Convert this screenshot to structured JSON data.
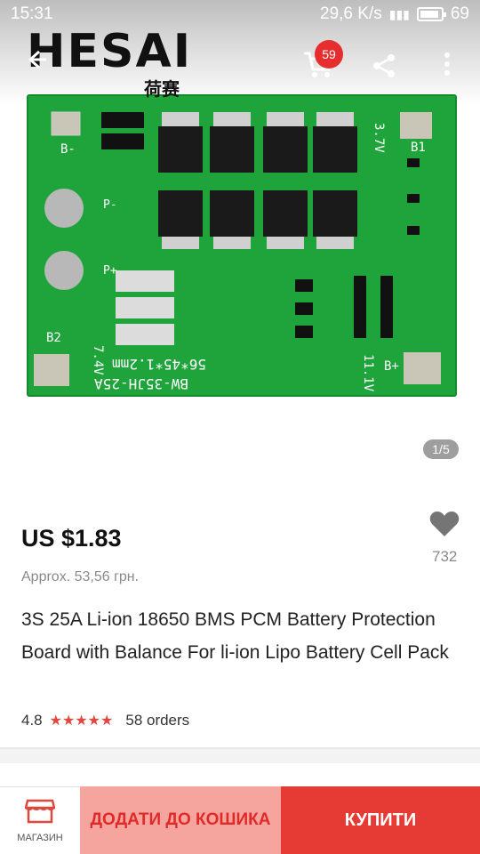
{
  "status_bar": {
    "time": "15:31",
    "network_speed": "29,6 K/s",
    "battery_percent": "69"
  },
  "header": {
    "logo_text": "HESAI",
    "logo_subtext": "荷赛",
    "cart_count": "59",
    "icons": {
      "back": "arrow-left-icon",
      "cart": "cart-icon",
      "share": "share-icon",
      "more": "more-vert-icon"
    }
  },
  "product_image": {
    "pcb_labels": [
      "B-",
      "3.7V",
      "B1",
      "P-",
      "P+",
      "B2",
      "7.4V",
      "56*45*1.2mm",
      "BW-35JH-25A",
      "11.1V",
      "B+"
    ],
    "pager": "1/5"
  },
  "product": {
    "price": "US $1.83",
    "approx_price": "Approx. 53,56 грн.",
    "favorites_count": "732",
    "title": "3S 25A Li-ion 18650 BMS PCM Battery Protection Board with Balance For li-ion Lipo Battery Cell Pack",
    "rating": "4.8",
    "orders": "58 orders"
  },
  "bottom_bar": {
    "store_label": "МАГАЗИН",
    "add_to_cart_label": "ДОДАТИ ДО КОШИКА",
    "buy_label": "КУПИТИ"
  },
  "colors": {
    "accent_red": "#e63b35",
    "add_cart_bg": "#f5a59e",
    "pcb_green": "#1fa33b",
    "badge_red": "#e62e2e"
  }
}
